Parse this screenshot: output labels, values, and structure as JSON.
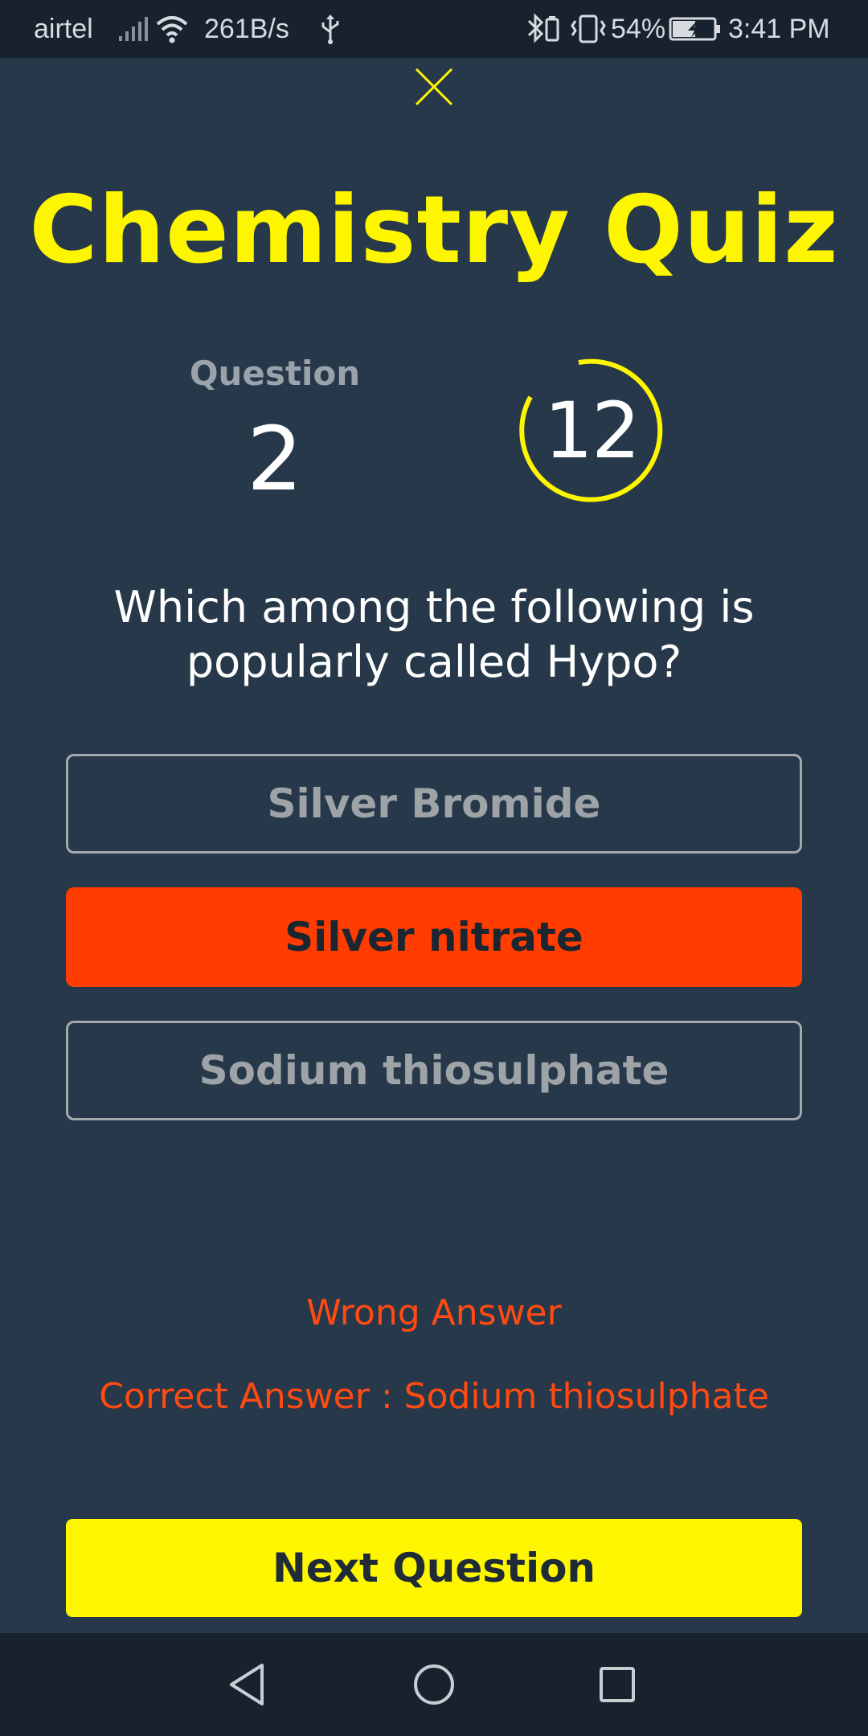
{
  "status_bar": {
    "carrier": "airtel",
    "net_speed": "261B/s",
    "battery_percent": "54%",
    "time": "3:41 PM",
    "icons": [
      "signal-icon",
      "wifi-icon",
      "usb-icon",
      "bluetooth-icon",
      "vibrate-icon",
      "battery-charging-icon"
    ]
  },
  "header": {
    "close_icon": "close-icon",
    "title": "Chemistry Quiz"
  },
  "progress": {
    "question_label": "Question",
    "question_number": "2",
    "timer_value": "12"
  },
  "question": {
    "text": "Which among the following is popularly called Hypo?"
  },
  "options": [
    {
      "label": "Silver Bromide",
      "state": "neutral"
    },
    {
      "label": "Silver nitrate",
      "state": "wrong"
    },
    {
      "label": "Sodium thiosulphate",
      "state": "neutral"
    }
  ],
  "feedback": {
    "result": "Wrong Answer",
    "correct_answer": "Correct Answer : Sodium thiosulphate"
  },
  "actions": {
    "next_label": "Next Question"
  },
  "colors": {
    "background": "#263849",
    "accent_yellow": "#fdf600",
    "wrong_red": "#ff3d00",
    "feedback_red": "#ff4a12"
  }
}
